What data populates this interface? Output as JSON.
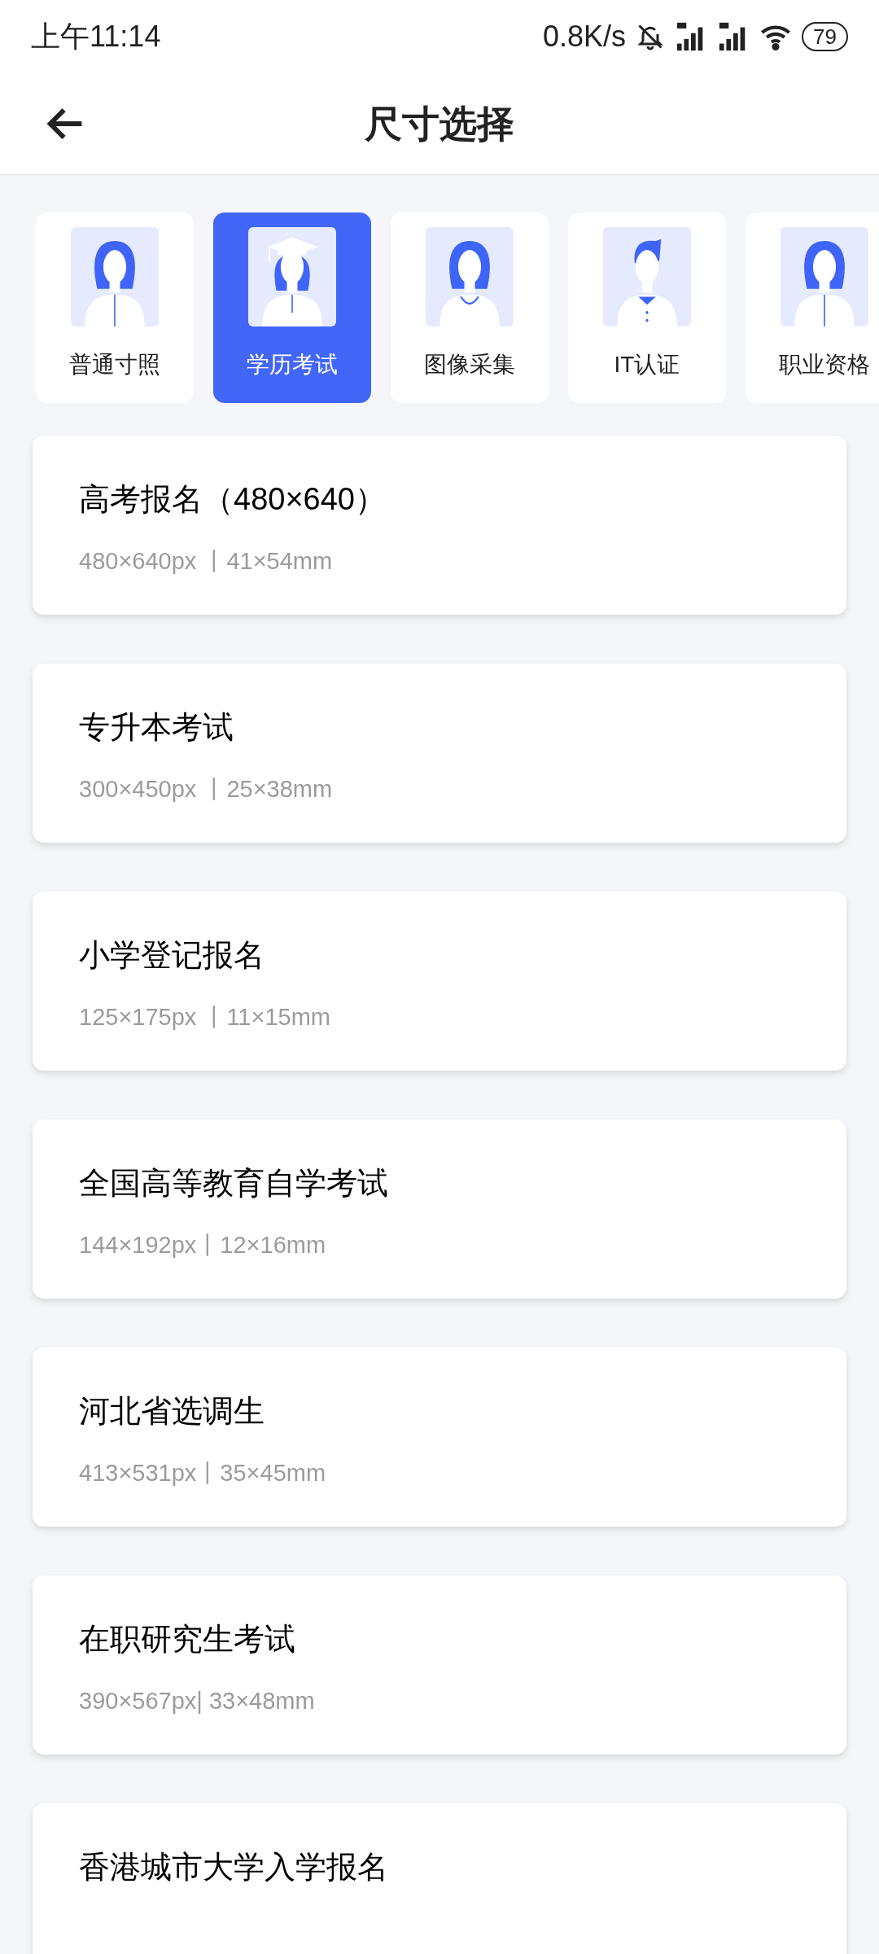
{
  "status_bar": {
    "time": "上午11:14",
    "net_speed": "0.8K/s",
    "battery": "79"
  },
  "header": {
    "title": "尺寸选择"
  },
  "categories": [
    {
      "label": "普通寸照",
      "kind": "female",
      "selected": false
    },
    {
      "label": "学历考试",
      "kind": "graduate",
      "selected": true
    },
    {
      "label": "图像采集",
      "kind": "round_neck",
      "selected": false
    },
    {
      "label": "IT认证",
      "kind": "male",
      "selected": false
    },
    {
      "label": "职业资格",
      "kind": "female",
      "selected": false
    }
  ],
  "sizes": [
    {
      "name": "高考报名（480×640）",
      "spec": "480×640px 丨41×54mm"
    },
    {
      "name": "专升本考试",
      "spec": "300×450px 丨25×38mm"
    },
    {
      "name": "小学登记报名",
      "spec": "125×175px 丨11×15mm"
    },
    {
      "name": "全国高等教育自学考试",
      "spec": "144×192px丨12×16mm"
    },
    {
      "name": "河北省选调生",
      "spec": "413×531px丨35×45mm"
    },
    {
      "name": "在职研究生考试",
      "spec": "390×567px| 33×48mm"
    },
    {
      "name": "香港城市大学入学报名"
    }
  ]
}
